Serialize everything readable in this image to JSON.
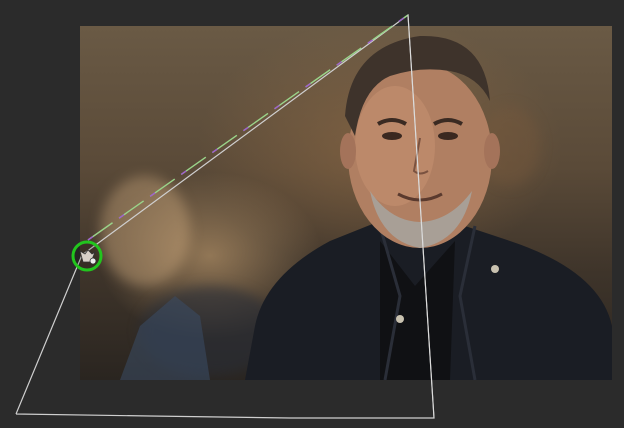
{
  "workspace": {
    "background_color": "#2b2b2b"
  },
  "canvas": {
    "image_subject": "portrait",
    "tool_icon": "warp-handle-icon"
  },
  "transform_guide": {
    "stroke_color": "#cfcfcf",
    "path_colors": [
      "#9ad48a",
      "#a05fd0"
    ]
  },
  "handle": {
    "ring_color": "#22c51e",
    "icon": "pin-icon"
  }
}
